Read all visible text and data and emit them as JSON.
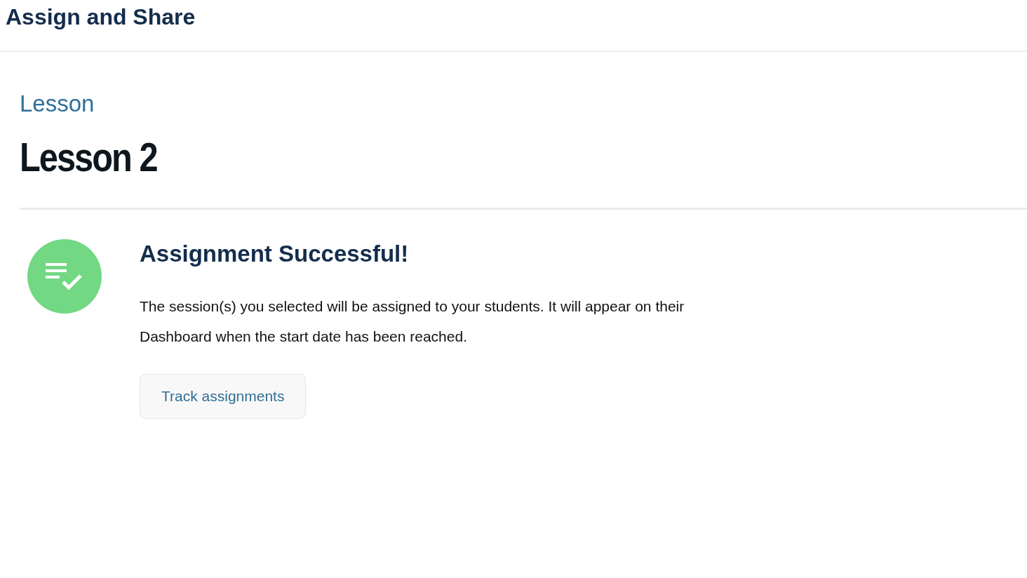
{
  "header": {
    "title": "Assign and Share"
  },
  "lesson": {
    "label": "Lesson",
    "title": "Lesson 2"
  },
  "confirmation": {
    "heading": "Assignment Successful!",
    "message": "The session(s) you selected will be assigned to your students. It will appear on their Dashboard when the start date has been reached.",
    "button": "Track assignments"
  }
}
